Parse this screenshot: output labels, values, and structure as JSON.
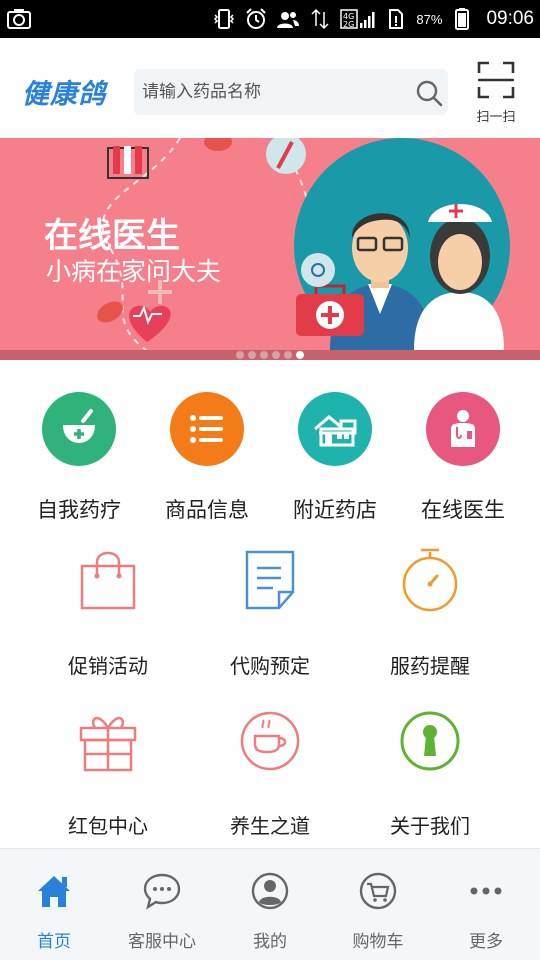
{
  "status_bar": {
    "battery_percent": "87%",
    "time": "09:06",
    "network": "4G"
  },
  "header": {
    "logo_text": "健康鸽",
    "search_placeholder": "请输入药品名称",
    "scan_label": "扫一扫"
  },
  "banner": {
    "title": "在线医生",
    "subtitle": "小病在家问大夫",
    "slide_count": 6,
    "active_slide": 6
  },
  "grid": {
    "row1": [
      {
        "label": "自我药疗",
        "color": "#2fb37b",
        "icon": "mortar-pestle-icon"
      },
      {
        "label": "商品信息",
        "color": "#f47c18",
        "icon": "list-icon"
      },
      {
        "label": "附近药店",
        "color": "#1fb3ad",
        "icon": "store-icon"
      },
      {
        "label": "在线医生",
        "color": "#e8577e",
        "icon": "doctor-icon"
      }
    ],
    "row2": [
      {
        "label": "促销活动",
        "icon": "shopping-bag-icon"
      },
      {
        "label": "代购预定",
        "icon": "document-icon"
      },
      {
        "label": "服药提醒",
        "icon": "stopwatch-icon"
      }
    ],
    "row3": [
      {
        "label": "红包中心",
        "icon": "gift-icon"
      },
      {
        "label": "养生之道",
        "icon": "tea-cup-icon"
      },
      {
        "label": "关于我们",
        "icon": "info-keyhole-icon"
      }
    ]
  },
  "bottom_nav": [
    {
      "label": "首页",
      "icon": "home-icon",
      "active": true
    },
    {
      "label": "客服中心",
      "icon": "chat-icon",
      "active": false
    },
    {
      "label": "我的",
      "icon": "user-icon",
      "active": false
    },
    {
      "label": "购物车",
      "icon": "cart-icon",
      "active": false
    },
    {
      "label": "更多",
      "icon": "more-icon",
      "active": false
    }
  ],
  "colors": {
    "accent": "#2a82d8",
    "banner_bg": "#f5808b",
    "outline_pink": "#ef7b7d",
    "outline_blue": "#4c8fd2",
    "outline_orange": "#f39a2a",
    "outline_green": "#5fb233"
  }
}
